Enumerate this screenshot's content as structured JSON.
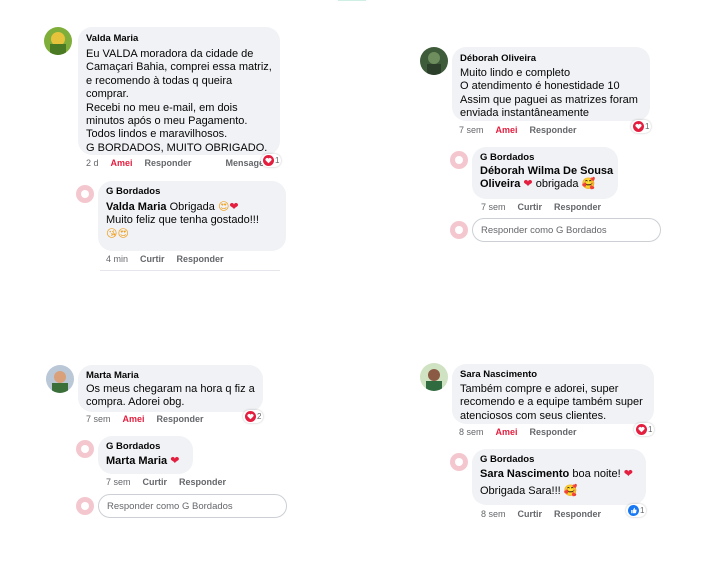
{
  "post1": {
    "author": "Valda Maria",
    "lines": [
      "Eu VALDA moradora da cidade de",
      "Camaçari Bahia, comprei essa matriz,",
      "e recomendo à todas q queira",
      "comprar.",
      "Recebi  no meu e-mail, em dois",
      "minutos após o meu Pagamento.",
      "Todos lindos e maravilhosos.",
      "G BORDADOS, MUITO OBRIGADO."
    ],
    "time": "2 d",
    "like": "Amei",
    "reply": "Responder",
    "message": "Mensagem",
    "react_count": "1",
    "response": {
      "author": "G Bordados",
      "mention": "Valda Maria",
      "line1": "Obrigada",
      "line2": "Muito feliz que tenha gostado!!!",
      "time": "4 min",
      "like": "Curtir",
      "reply": "Responder"
    }
  },
  "post2": {
    "author": "Déborah Oliveira",
    "lines": [
      "Muito lindo e completo",
      "O atendimento é honestidade 10",
      "Assim que  paguei as matrizes foram",
      "enviada instantâneamente"
    ],
    "time": "7 sem",
    "like": "Amei",
    "reply": "Responder",
    "react_count": "1",
    "response": {
      "author": "G Bordados",
      "mention1": "Déborah Wilma De Sousa",
      "mention2": "Oliveira",
      "text": "obrigada",
      "time": "7 sem",
      "like": "Curtir",
      "reply": "Responder"
    },
    "reply_placeholder": "Responder como G Bordados"
  },
  "post3": {
    "author": "Marta Maria",
    "lines": [
      "Os meus chegaram na hora q fiz a",
      "compra. Adorei obg."
    ],
    "time": "7 sem",
    "like": "Amei",
    "reply": "Responder",
    "react_count": "2",
    "response": {
      "author": "G Bordados",
      "mention": "Marta Maria",
      "time": "7 sem",
      "like": "Curtir",
      "reply": "Responder"
    },
    "reply_placeholder": "Responder como G Bordados"
  },
  "post4": {
    "author": "Sara Nascimento",
    "lines": [
      "Também compre e adorei, super",
      "recomendo e a equipe também super",
      "atenciosos com seus clientes."
    ],
    "time": "8 sem",
    "like": "Amei",
    "reply": "Responder",
    "react_count": "1",
    "response": {
      "author": "G Bordados",
      "mention": "Sara Nascimento",
      "line1": "boa noite!",
      "line2": "Obrigada Sara!!!",
      "time": "8 sem",
      "like": "Curtir",
      "reply": "Responder",
      "react_count": "1"
    }
  },
  "colors": {
    "bubble": "#f0f2f5",
    "love_red": "#e41e3f",
    "meta_gray": "#65676b",
    "like_blue": "#1877f2"
  },
  "icons": [
    "heart-reaction-icon",
    "like-reaction-icon",
    "heart-eyes-emoji",
    "smiling-face-hearts-emoji",
    "kissing-heart-emoji"
  ]
}
